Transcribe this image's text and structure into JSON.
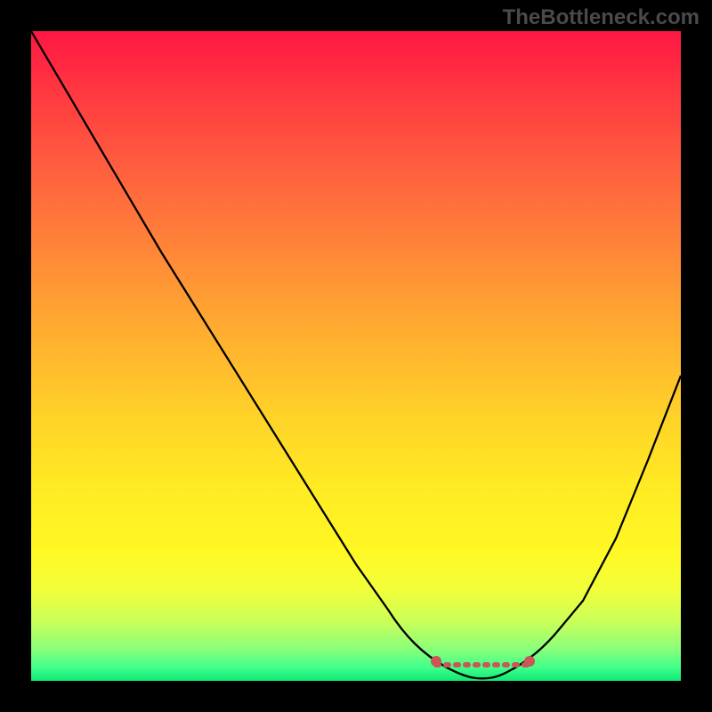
{
  "watermark": "TheBottleneck.com",
  "chart_data": {
    "type": "line",
    "title": "",
    "xlabel": "",
    "ylabel": "",
    "xlim": [
      0,
      100
    ],
    "ylim": [
      0,
      100
    ],
    "series": [
      {
        "name": "bottleneck-curve",
        "x": [
          0,
          10,
          20,
          30,
          40,
          50,
          55,
          60,
          64,
          68,
          72,
          76,
          80,
          85,
          90,
          95,
          100
        ],
        "y": [
          100,
          83,
          66,
          50,
          34,
          18,
          11,
          5,
          2,
          0,
          0,
          2,
          5,
          12,
          22,
          34,
          47
        ]
      },
      {
        "name": "optimal-range",
        "x": [
          62,
          78
        ],
        "y": [
          2,
          2
        ]
      }
    ],
    "colors": {
      "curve": "#000000",
      "optimal_range": "#cc5555",
      "gradient_top": "#ff1744",
      "gradient_bottom": "#0ee874"
    }
  }
}
